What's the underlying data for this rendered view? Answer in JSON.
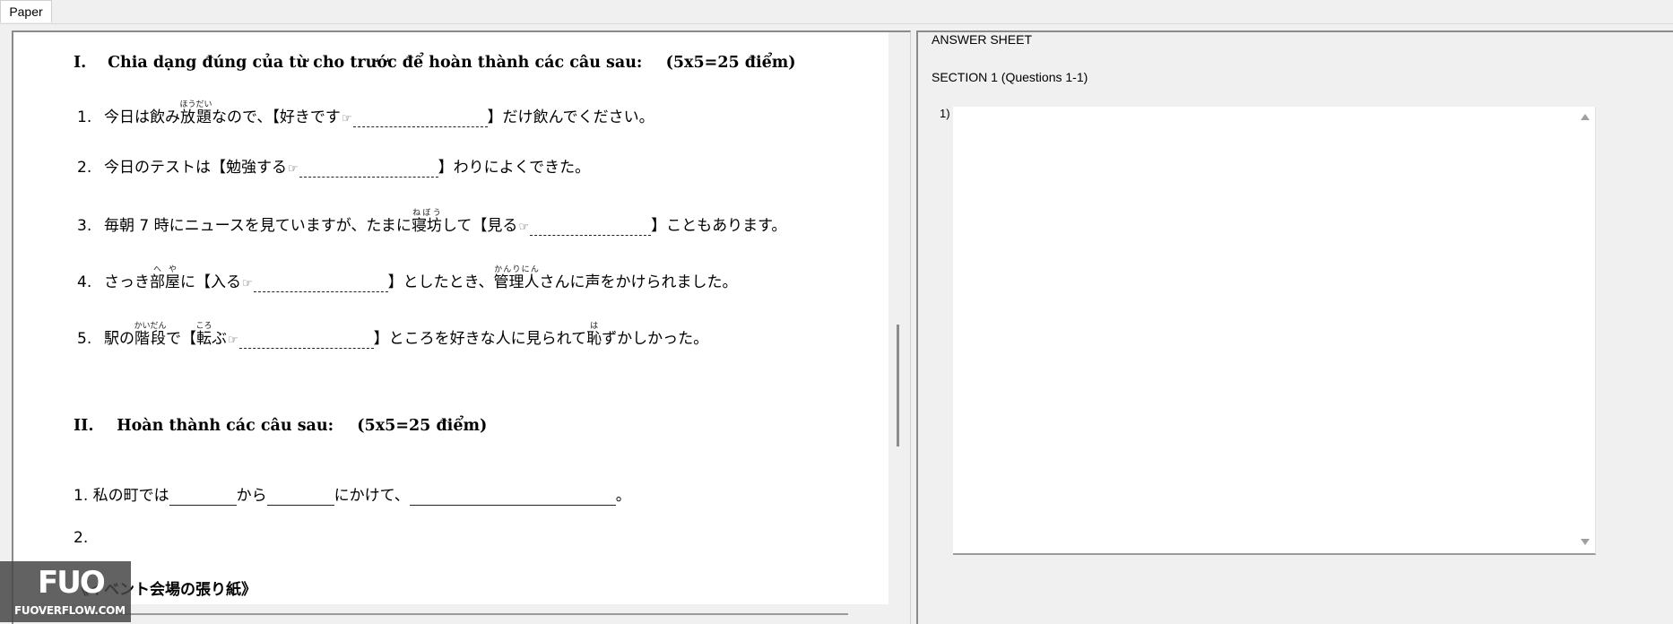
{
  "tab": {
    "label": "Paper"
  },
  "paper": {
    "section1": {
      "roman": "I.",
      "title": "Chia dạng đúng của từ cho trước để hoàn thành các câu sau:",
      "score": "(5x5=25 điểm)",
      "questions": [
        {
          "num": "1.",
          "a1": "今日は飲み",
          "ruby_base": "放題",
          "ruby_text": "ほうだい",
          "a2": "なので、【好きです",
          "b": "】だけ飲んでください。"
        },
        {
          "num": "2.",
          "a": "今日のテストは【勉強する",
          "b": "】わりによくできた。"
        },
        {
          "num": "3.",
          "a1": "毎朝 7 時にニュースを見ていますが、たまに",
          "ruby_base": "寝坊",
          "ruby_text": "ねぼう",
          "a2": "して【見る",
          "b": "】こともあります。"
        },
        {
          "num": "4.",
          "a1": "さっき",
          "ruby1_base": "部屋",
          "ruby1_text": "へや",
          "a2": "に【入る",
          "b1": "】としたとき、",
          "ruby2_base": "管理人",
          "ruby2_text": "かんりにん",
          "b2": "さんに声をかけられました。"
        },
        {
          "num": "5.",
          "a1": "駅の",
          "ruby1_base": "階段",
          "ruby1_text": "かいだん",
          "a2": "で【",
          "ruby2_base": "転",
          "ruby2_text": "ころ",
          "a3": "ぶ",
          "b1": "】ところを好きな人に見られて",
          "ruby3_base": "恥",
          "ruby3_text": "は",
          "b2": "ずかしかった。"
        }
      ]
    },
    "section2": {
      "roman": "II.",
      "title": "Hoàn thành các câu sau:",
      "score": "(5x5=25 điểm)",
      "q1": {
        "p1": "1. 私の町では",
        "p2": "から",
        "p3": "にかけて、",
        "p4": "。"
      },
      "q2": {
        "p1": "2."
      },
      "q3": {
        "p1": "《イベント会場の張り紙》"
      }
    }
  },
  "answer_sheet": {
    "title": "ANSWER SHEET",
    "section_heading": "SECTION 1 (Questions 1-1)",
    "question_label": "1)",
    "answer_value": ""
  },
  "watermark": {
    "mark": "FUO",
    "text": "FUOVERFLOW.COM"
  },
  "icons": {
    "blank_pointer": "pointing-hand-icon",
    "scroll_up": "scroll-up-arrow-icon",
    "scroll_down": "scroll-down-arrow-icon"
  },
  "colors": {
    "background": "#f0f0f0",
    "paper": "#ffffff",
    "frame": "#8a8a8a"
  }
}
